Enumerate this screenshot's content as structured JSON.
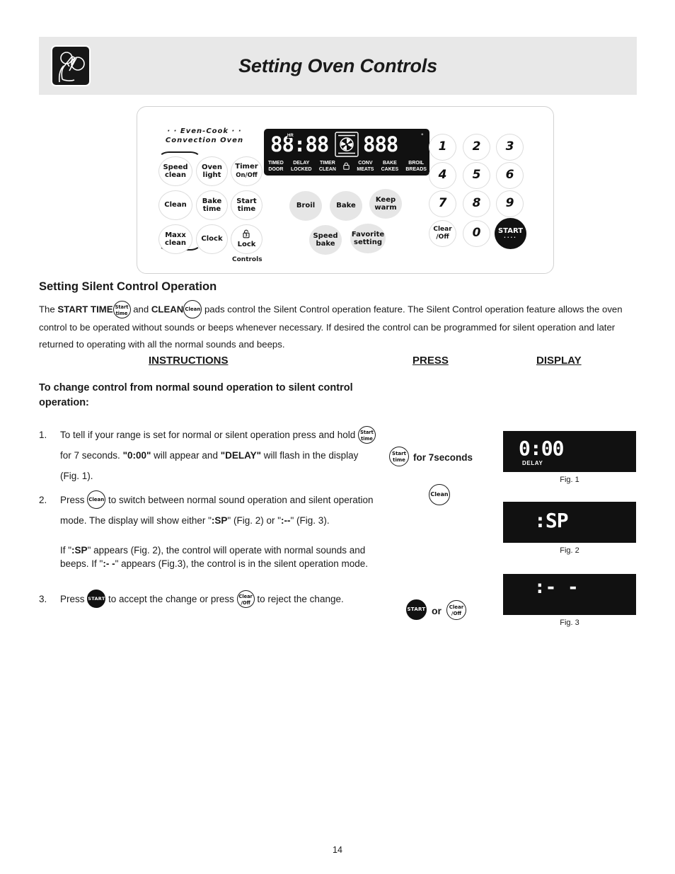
{
  "header": {
    "title": "Setting Oven Controls",
    "icon": "hand-pressing-knob-icon"
  },
  "control_panel": {
    "brand_line1": "· · Even-Cook · ·",
    "brand_line2": "Convection Oven",
    "left_pads": [
      {
        "name": "speed-clean",
        "l1": "Speed",
        "l2": "clean"
      },
      {
        "name": "oven-light",
        "l1": "Oven",
        "l2": "light"
      },
      {
        "name": "timer-on-off",
        "l1": "Timer",
        "l2": "On/Off"
      },
      {
        "name": "clean",
        "l1": "Clean",
        "l2": ""
      },
      {
        "name": "bake-time",
        "l1": "Bake",
        "l2": "time"
      },
      {
        "name": "start-time",
        "l1": "Start",
        "l2": "time"
      },
      {
        "name": "maxx-clean",
        "l1": "Maxx",
        "l2": "clean"
      },
      {
        "name": "clock",
        "l1": "Clock",
        "l2": ""
      },
      {
        "name": "lock",
        "l1": "",
        "l2": "Lock"
      }
    ],
    "controls_caption": "Controls",
    "mid_pads": [
      {
        "name": "broil",
        "l1": "Broil",
        "l2": ""
      },
      {
        "name": "bake",
        "l1": "Bake",
        "l2": ""
      },
      {
        "name": "keep-warm",
        "l1": "Keep",
        "l2": "warm"
      },
      {
        "name": "speed-bake",
        "l1": "Speed",
        "l2": "bake"
      },
      {
        "name": "favorite-setting",
        "l1": "Favorite",
        "l2": "setting"
      }
    ],
    "keypad": [
      "1",
      "2",
      "3",
      "4",
      "5",
      "6",
      "7",
      "8",
      "9"
    ],
    "clear_off_l1": "Clear",
    "clear_off_l2": "/Off",
    "zero": "0",
    "start": "START",
    "vfd": {
      "time_digits": "88:88",
      "hr_tag": "HR",
      "temp_digits": "888",
      "degree": "°",
      "indicators": [
        {
          "top": "TIMED",
          "bottom": "DOOR"
        },
        {
          "top": "DELAY",
          "bottom": "LOCKED"
        },
        {
          "top": "TIMER",
          "bottom": "CLEAN"
        },
        {
          "top": "",
          "bottom": ""
        },
        {
          "top": "CONV",
          "bottom": "MEATS"
        },
        {
          "top": "BAKE",
          "bottom": "CAKES"
        },
        {
          "top": "BROIL",
          "bottom": "BREADS"
        }
      ]
    }
  },
  "section": {
    "heading": "Setting Silent Control Operation",
    "intro_a": "The ",
    "intro_start_time": "START TIME",
    "intro_b": " and ",
    "intro_clean": "CLEAN",
    "intro_c": " pads control the Silent Control operation feature. The Silent Control operation feature allows the oven control to be operated without sounds or beeps whenever necessary. If desired the control can be programmed for silent operation and later returned to operating with all the normal sounds and beeps."
  },
  "columns": {
    "instructions": "INSTRUCTIONS",
    "press": "PRESS",
    "display": "DISPLAY"
  },
  "task_title": "To change control from normal sound operation to silent control operation:",
  "steps": [
    {
      "num": "1.",
      "p1": "To tell if your range is set for normal or silent operation press and hold ",
      "key": "start-time",
      "p2": " for 7 seconds. ",
      "b1": "\"0:00\"",
      "p3": " will appear and ",
      "b2": "\"DELAY\"",
      "p4": " will flash in the display (Fig. 1)."
    },
    {
      "num": "2.",
      "p1": "Press ",
      "key": "clean",
      "p2": " to switch between normal sound operation and silent operation mode. The display will show either \"",
      "b1": ":SP",
      "p3": "\" (Fig. 2) or \"",
      "b2": ":--",
      "p4": "\" (Fig. 3)."
    },
    {
      "num": "3.",
      "p1": "Press ",
      "key": "start",
      "p2": " to accept the change or press ",
      "key2": "clear-off",
      "p3": " to reject the change."
    }
  ],
  "note": {
    "a": "If \"",
    "b1": ":SP",
    "c": "\" appears (Fig. 2), the control will operate with normal sounds and beeps.  If \"",
    "b2": ":- -",
    "d": "\" appears (Fig.3), the control is in the silent operation mode."
  },
  "press_column": [
    {
      "key": "start-time",
      "k1": "Start",
      "k2": "time",
      "label": "for 7seconds"
    },
    {
      "key": "clean",
      "k1": "Clean",
      "k2": "",
      "label": ""
    },
    {
      "key": "start",
      "k1": "START",
      "k2": "",
      "or": "or",
      "key2": "clear-off",
      "k3": "Clear",
      "k4": "/Off"
    }
  ],
  "display_column": [
    {
      "name": "fig-1",
      "value": "0:00",
      "sub": "DELAY",
      "caption": "Fig. 1"
    },
    {
      "name": "fig-2",
      "value": ":SP",
      "sub": "",
      "caption": "Fig. 2"
    },
    {
      "name": "fig-3",
      "value": ":- -",
      "sub": "",
      "caption": "Fig. 3"
    }
  ],
  "page_number": "14",
  "colors": {
    "banner": "#e8e8e8",
    "display_black": "#111111",
    "pad_gray": "#e6e6e6"
  }
}
